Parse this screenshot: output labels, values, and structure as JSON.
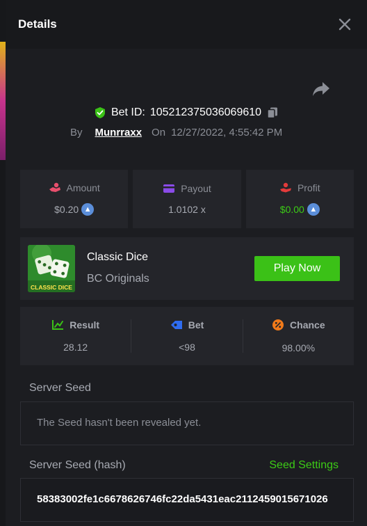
{
  "modal": {
    "title": "Details"
  },
  "bet": {
    "id_label": "Bet ID:",
    "id": "105212375036069610",
    "by_label": "By",
    "user": "Munrraxx",
    "on_label": "On",
    "datetime": "12/27/2022, 4:55:42 PM"
  },
  "stats": [
    {
      "label": "Amount",
      "value": "$0.20",
      "icon": "money-hand-icon",
      "color": "#e94f6d"
    },
    {
      "label": "Payout",
      "value": "1.0102 x",
      "icon": "wallet-icon",
      "color": "#8a4be8"
    },
    {
      "label": "Profit",
      "value": "$0.00",
      "icon": "hand-coin-icon",
      "color": "#e33b3b"
    }
  ],
  "game": {
    "name": "Classic Dice",
    "provider": "BC Originals",
    "thumb_text": "CLASSIC DICE",
    "play_label": "Play Now"
  },
  "result": {
    "result_label": "Result",
    "result_value": "28.12",
    "bet_label": "Bet",
    "bet_value": "<98",
    "chance_label": "Chance",
    "chance_value": "98.00%"
  },
  "seeds": {
    "server_seed_label": "Server Seed",
    "server_seed_placeholder": "The Seed hasn't been revealed yet.",
    "server_seed_hash_label": "Server Seed (hash)",
    "seed_settings_label": "Seed Settings",
    "server_seed_hash": "58383002fe1c6678626746fc22da5431eac2112459015671026"
  },
  "colors": {
    "accent_green": "#3bc117",
    "panel": "#24252a",
    "background": "#1c1d21"
  }
}
